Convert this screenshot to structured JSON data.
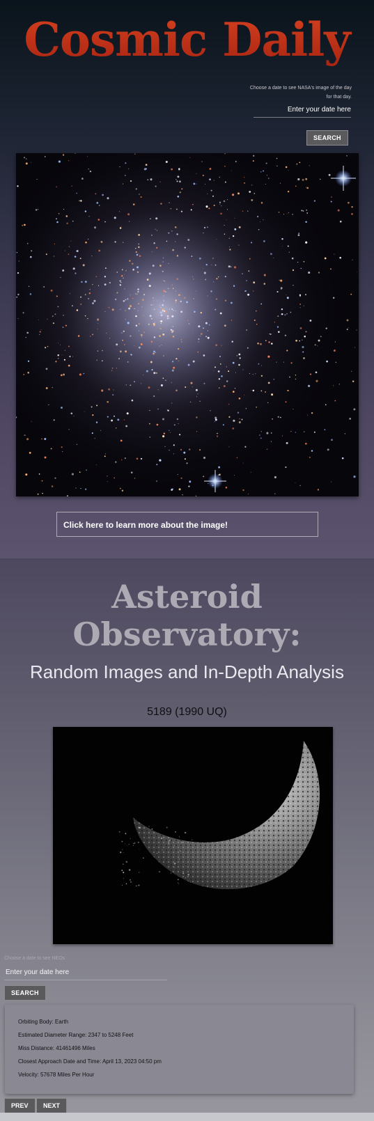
{
  "apod": {
    "title": "Cosmic Daily",
    "date_caption": "Choose a date to see NASA's image of the day for that day.",
    "date_placeholder": "Enter your date here",
    "search_label": "SEARCH",
    "image_icon": "star-cluster-image",
    "learn_more_label": "Click here to learn more about the image!"
  },
  "neo": {
    "title_line1": "Asteroid",
    "title_line2": "Observatory:",
    "subtitle": "Random Images and In-Depth Analysis",
    "asteroid_name": "5189 (1990 UQ)",
    "image_icon": "asteroid-image",
    "date_caption": "Choose a date to see NEOs",
    "date_placeholder": "Enter your date here",
    "search_label": "SEARCH",
    "details": {
      "orbiting_body": "Orbiting Body: Earth",
      "diameter": "Estimated Diameter Range: 2347 to 5248 Feet",
      "miss_distance": "Miss Distance: 41461496 Miles",
      "approach": "Closest Approach Date and Time: April 13, 2023 04:50 pm",
      "velocity": "Velocity: 57678 Miles Per Hour"
    },
    "prev_label": "PREV",
    "next_label": "NEXT"
  },
  "colors": {
    "title_red": "#c23a1e",
    "button_gray": "#5a5a5c"
  }
}
